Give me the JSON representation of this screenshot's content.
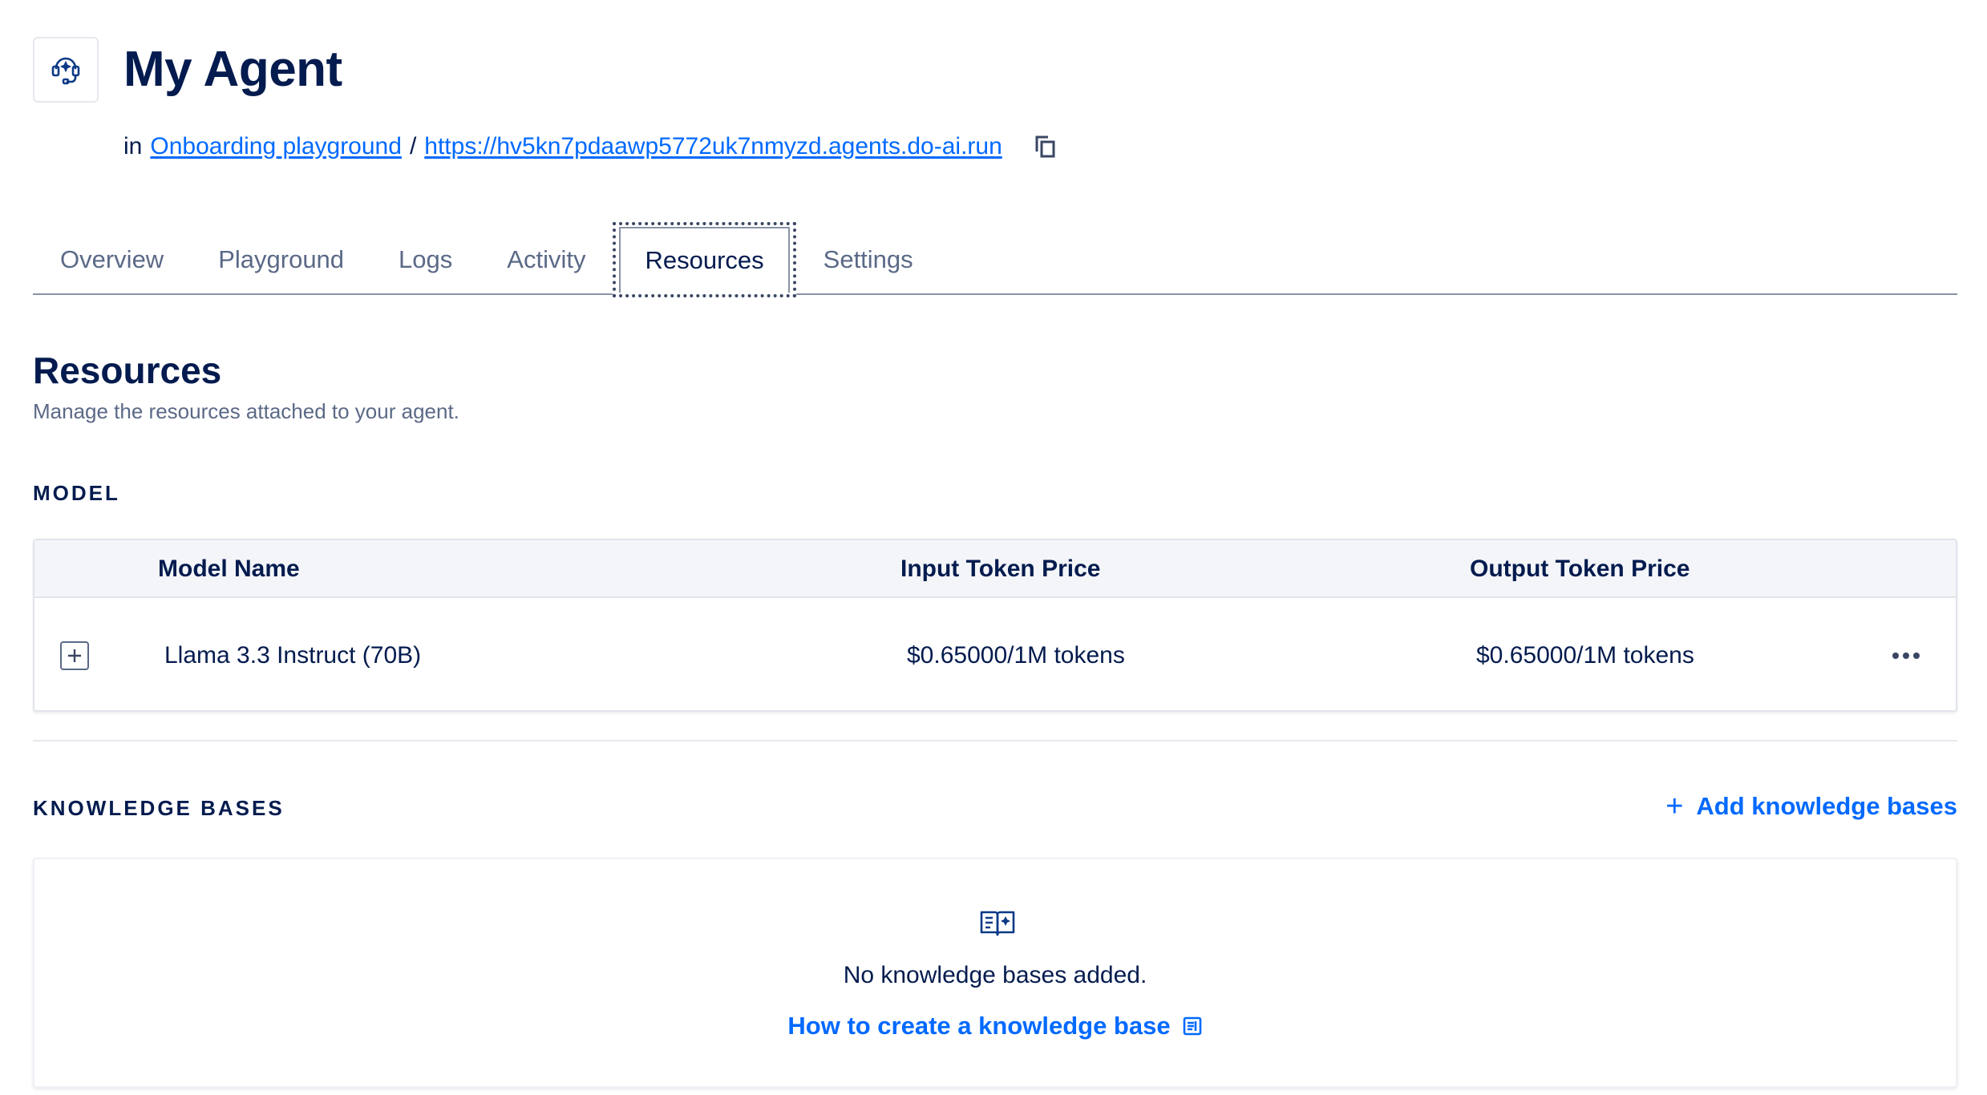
{
  "header": {
    "title": "My Agent",
    "prefix": "in",
    "workspace_link": "Onboarding playground",
    "separator": "/",
    "endpoint_url": "https://hv5kn7pdaawp5772uk7nmyzd.agents.do-ai.run"
  },
  "tabs": [
    {
      "label": "Overview"
    },
    {
      "label": "Playground"
    },
    {
      "label": "Logs"
    },
    {
      "label": "Activity"
    },
    {
      "label": "Resources",
      "active": true
    },
    {
      "label": "Settings"
    }
  ],
  "section": {
    "title": "Resources",
    "description": "Manage the resources attached to your agent."
  },
  "model": {
    "label": "MODEL",
    "columns": [
      "Model Name",
      "Input Token Price",
      "Output Token Price"
    ],
    "rows": [
      {
        "name": "Llama 3.3 Instruct (70B)",
        "input_price": "$0.65000/1M tokens",
        "output_price": "$0.65000/1M tokens"
      }
    ]
  },
  "knowledge_bases": {
    "label": "KNOWLEDGE BASES",
    "add_label": "Add knowledge bases",
    "empty_text": "No knowledge bases added.",
    "help_link": "How to create a knowledge base"
  },
  "icons": {
    "agent": "agent-headset-icon",
    "copy": "copy-icon",
    "expand": "plus-square-icon",
    "more": "ellipsis-icon",
    "add": "plus-icon",
    "kb": "book-sparkle-icon",
    "external": "doc-link-icon"
  },
  "colors": {
    "primary_text": "#031b4e",
    "secondary_text": "#5b6987",
    "link": "#0069ff",
    "table_header_bg": "#f3f5f9",
    "border": "#e1e4ea"
  }
}
